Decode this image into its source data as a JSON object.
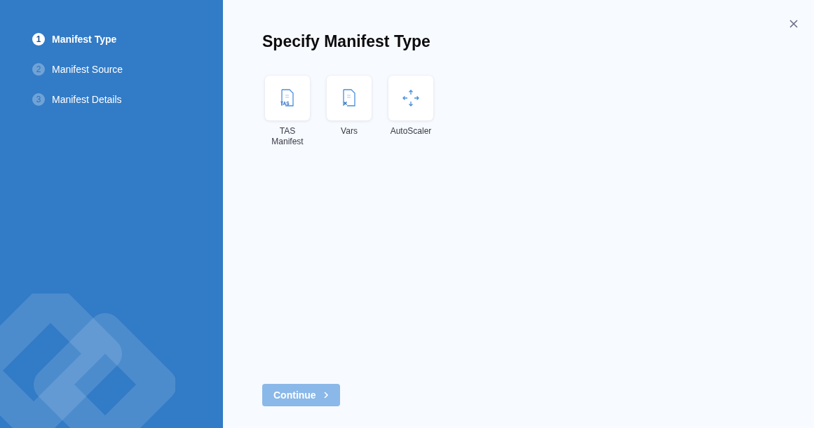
{
  "steps": [
    {
      "number": "1",
      "label": "Manifest Type",
      "selected": true
    },
    {
      "number": "2",
      "label": "Manifest Source",
      "selected": false
    },
    {
      "number": "3",
      "label": "Manifest Details",
      "selected": false
    }
  ],
  "title": "Specify Manifest Type",
  "manifest_types": [
    {
      "kind": "file-tas",
      "label": "TAS Manifest",
      "icon_label": "TAS",
      "selected": false
    },
    {
      "kind": "file-vars",
      "label": "Vars",
      "selected": false
    },
    {
      "kind": "autoscaler",
      "label": "AutoScaler",
      "selected": false
    }
  ],
  "continue_button": {
    "label": "Continue",
    "disabled": true
  }
}
